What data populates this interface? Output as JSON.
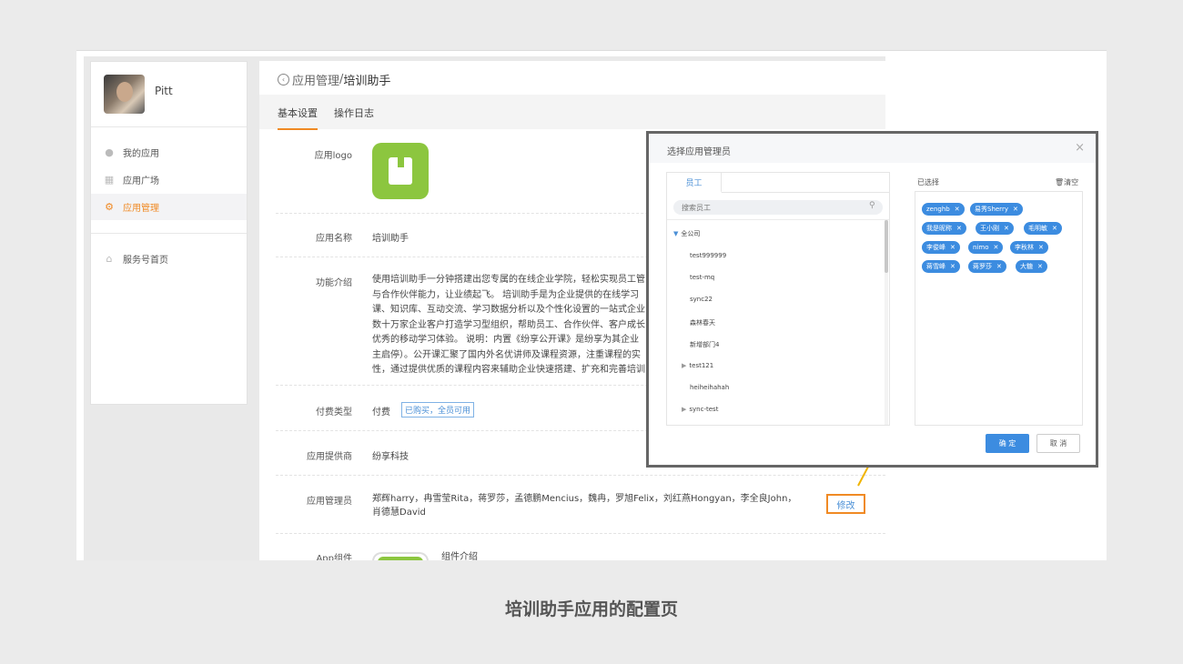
{
  "sidebar": {
    "username": "Pitt",
    "items": [
      {
        "label": "我的应用"
      },
      {
        "label": "应用广场"
      },
      {
        "label": "应用管理"
      },
      {
        "label": "服务号首页"
      }
    ]
  },
  "breadcrumb": {
    "parent": "应用管理",
    "separator": " / ",
    "current": "培训助手"
  },
  "tabs": [
    "基本设置",
    "操作日志"
  ],
  "fields": {
    "logo_label": "应用logo",
    "name_label": "应用名称",
    "name_value": "培训助手",
    "intro_label": "功能介绍",
    "intro_lines": [
      "使用培训助手一分钟搭建出您专属的在线企业学院，轻松实现员工管",
      "与合作伙伴能力，让业绩起飞。 培训助手是为企业提供的在线学习",
      "课、知识库、互动交流、学习数据分析以及个性化设置的一站式企业",
      "数十万家企业客户打造学习型组织，帮助员工、合作伙伴、客户成长",
      "优秀的移动学习体验。 说明：内置《纷享公开课》是纷享为其企业",
      "主启停）。公开课汇聚了国内外名优讲师及课程资源，注重课程的实",
      "性，通过提供优质的课程内容来辅助企业快速搭建、扩充和完善培训"
    ],
    "pay_label": "付费类型",
    "pay_value": "付费",
    "pay_tag": "已购买，全员可用",
    "provider_label": "应用提供商",
    "provider_value": "纷享科技",
    "admins_label": "应用管理员",
    "admins_line1": "郑辉harry，冉雪莹Rita，蒋罗莎，孟德鹏Mencius，魏冉，罗旭Felix，刘红燕Hongyan，李全良John，",
    "admins_line2": "肖德慧David",
    "modify_label": "修改",
    "component_label": "App组件",
    "component_value": "组件介绍"
  },
  "dialog": {
    "title": "选择应用管理员",
    "tab": "员工",
    "search_placeholder": "搜索员工",
    "tree": [
      {
        "label": "全公司",
        "level": 0,
        "caret": "expanded"
      },
      {
        "label": "test999999",
        "level": 1,
        "caret": "none"
      },
      {
        "label": "test-mq",
        "level": 1,
        "caret": "none"
      },
      {
        "label": "sync22",
        "level": 1,
        "caret": "none"
      },
      {
        "label": "森林春天",
        "level": 1,
        "caret": "none"
      },
      {
        "label": "新增部门4",
        "level": 1,
        "caret": "none"
      },
      {
        "label": "test121",
        "level": 1,
        "caret": "collapsed"
      },
      {
        "label": "heiheihahah",
        "level": 1,
        "caret": "none"
      },
      {
        "label": "sync-test",
        "level": 1,
        "caret": "collapsed"
      }
    ],
    "selected_label": "已选择",
    "clear_label": "清空",
    "chips": [
      "zenghb",
      "易秀Sherry",
      "我是昵称",
      "王小刚",
      "毛明敏",
      "李俊峰",
      "nimo",
      "李秋林",
      "蒋雪峰",
      "蒋罗莎",
      "大糖"
    ],
    "ok_label": "确 定",
    "cancel_label": "取 消"
  },
  "caption": "培训助手应用的配置页"
}
